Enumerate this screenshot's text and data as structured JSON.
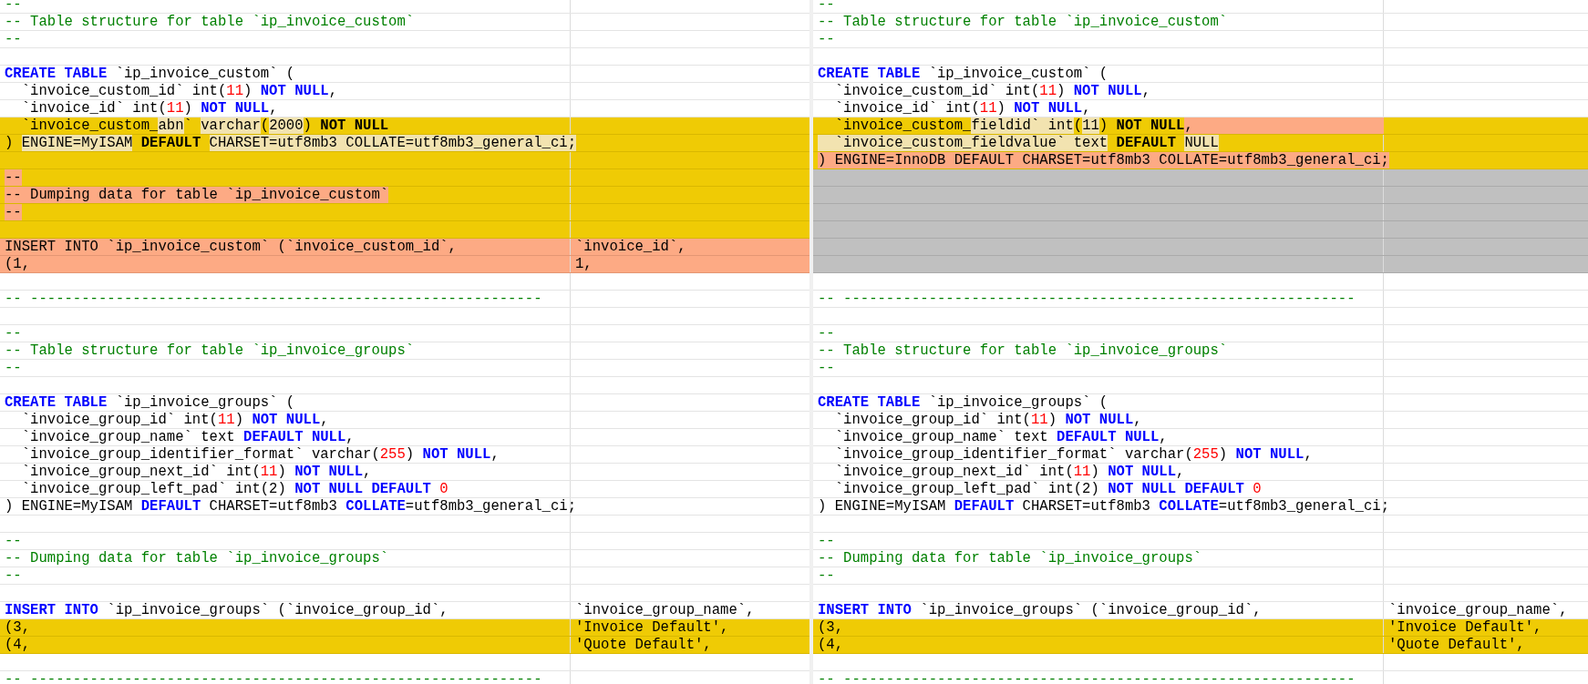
{
  "panes": [
    {
      "rows": [
        {
          "kind": "same",
          "cells": [
            [
              {
                "t": "--",
                "kind": "comment"
              }
            ]
          ]
        },
        {
          "kind": "same",
          "cells": [
            [
              {
                "t": "-- Table structure for table `ip_invoice_custom`",
                "kind": "comment"
              }
            ]
          ]
        },
        {
          "kind": "same",
          "cells": [
            [
              {
                "t": "--",
                "kind": "comment"
              }
            ]
          ]
        },
        {
          "kind": "same"
        },
        {
          "kind": "same",
          "cells": [
            [
              {
                "t": "CREATE TABLE",
                "kind": "keyword"
              },
              {
                "t": " `ip_invoice_custom` ("
              }
            ]
          ]
        },
        {
          "kind": "same",
          "cells": [
            [
              {
                "t": "  `invoice_custom_id` int("
              },
              {
                "t": "11",
                "kind": "number"
              },
              {
                "t": ") "
              },
              {
                "t": "NOT NULL",
                "kind": "keyword"
              },
              {
                "t": ","
              }
            ]
          ]
        },
        {
          "kind": "same",
          "cells": [
            [
              {
                "t": "  `invoice_id` int("
              },
              {
                "t": "11",
                "kind": "number"
              },
              {
                "t": ") "
              },
              {
                "t": "NOT NULL",
                "kind": "keyword"
              },
              {
                "t": ","
              }
            ]
          ]
        },
        {
          "kind": "changed",
          "cells": [
            [
              {
                "t": "  `invoice_custom_"
              },
              {
                "t": "abn",
                "word_changed": true
              },
              {
                "t": "` "
              },
              {
                "t": "varchar",
                "word_changed": true
              },
              {
                "t": "("
              },
              {
                "t": "2000",
                "word_changed": true
              },
              {
                "t": ") "
              },
              {
                "t": "NOT NULL",
                "kind": "keyword"
              }
            ]
          ]
        },
        {
          "kind": "changed",
          "cells": [
            [
              {
                "t": ") "
              },
              {
                "t": "ENGINE=MyISAM",
                "word_changed": true
              },
              {
                "t": " DEFAULT ",
                "kind": "keyword"
              },
              {
                "t": "CHARSET=utf8mb3 COLLATE=utf8mb3_general_ci;",
                "word_changed": true
              }
            ]
          ]
        },
        {
          "kind": "changed"
        },
        {
          "kind": "changed",
          "cells": [
            [
              {
                "t": "--",
                "kind": "comment",
                "deleted": true
              }
            ]
          ]
        },
        {
          "kind": "changed",
          "cells": [
            [
              {
                "t": "-- Dumping data for table `ip_invoice_custom`",
                "kind": "comment",
                "deleted": true
              }
            ]
          ]
        },
        {
          "kind": "changed",
          "cells": [
            [
              {
                "t": "--",
                "kind": "comment",
                "deleted": true
              }
            ]
          ]
        },
        {
          "kind": "changed"
        },
        {
          "kind": "removed",
          "cells": [
            [
              {
                "t": "INSERT INTO `ip_invoice_custom` (`invoice_custom_id`,"
              }
            ],
            [
              {
                "t": "`invoice_id`,"
              }
            ]
          ]
        },
        {
          "kind": "removed",
          "cells": [
            [
              {
                "t": "(1,"
              }
            ],
            [
              {
                "t": "1,"
              }
            ]
          ]
        },
        {
          "kind": "same"
        },
        {
          "kind": "same",
          "cells": [
            [
              {
                "t": "-- ------------------------------------------------------------",
                "kind": "comment"
              }
            ]
          ]
        },
        {
          "kind": "same"
        },
        {
          "kind": "same",
          "cells": [
            [
              {
                "t": "--",
                "kind": "comment"
              }
            ]
          ]
        },
        {
          "kind": "same",
          "cells": [
            [
              {
                "t": "-- Table structure for table `ip_invoice_groups`",
                "kind": "comment"
              }
            ]
          ]
        },
        {
          "kind": "same",
          "cells": [
            [
              {
                "t": "--",
                "kind": "comment"
              }
            ]
          ]
        },
        {
          "kind": "same"
        },
        {
          "kind": "same",
          "cells": [
            [
              {
                "t": "CREATE TABLE",
                "kind": "keyword"
              },
              {
                "t": " `ip_invoice_groups` ("
              }
            ]
          ]
        },
        {
          "kind": "same",
          "cells": [
            [
              {
                "t": "  `invoice_group_id` int("
              },
              {
                "t": "11",
                "kind": "number"
              },
              {
                "t": ") "
              },
              {
                "t": "NOT NULL",
                "kind": "keyword"
              },
              {
                "t": ","
              }
            ]
          ]
        },
        {
          "kind": "same",
          "cells": [
            [
              {
                "t": "  `invoice_group_name` text "
              },
              {
                "t": "DEFAULT NULL",
                "kind": "keyword"
              },
              {
                "t": ","
              }
            ]
          ]
        },
        {
          "kind": "same",
          "cells": [
            [
              {
                "t": "  `invoice_group_identifier_format` varchar("
              },
              {
                "t": "255",
                "kind": "number"
              },
              {
                "t": ") "
              },
              {
                "t": "NOT NULL",
                "kind": "keyword"
              },
              {
                "t": ","
              }
            ]
          ]
        },
        {
          "kind": "same",
          "cells": [
            [
              {
                "t": "  `invoice_group_next_id` int("
              },
              {
                "t": "11",
                "kind": "number"
              },
              {
                "t": ") "
              },
              {
                "t": "NOT NULL",
                "kind": "keyword"
              },
              {
                "t": ","
              }
            ]
          ]
        },
        {
          "kind": "same",
          "cells": [
            [
              {
                "t": "  `invoice_group_left_pad` int(2) "
              },
              {
                "t": "NOT NULL DEFAULT ",
                "kind": "keyword"
              },
              {
                "t": "0",
                "kind": "number"
              }
            ]
          ]
        },
        {
          "kind": "same",
          "cells": [
            [
              {
                "t": ") ENGINE=MyISAM "
              },
              {
                "t": "DEFAULT",
                "kind": "keyword"
              },
              {
                "t": " CHARSET=utf8mb3 "
              },
              {
                "t": "COLLATE",
                "kind": "keyword"
              },
              {
                "t": "=utf8mb3_general_ci;"
              }
            ]
          ]
        },
        {
          "kind": "same"
        },
        {
          "kind": "same",
          "cells": [
            [
              {
                "t": "--",
                "kind": "comment"
              }
            ]
          ]
        },
        {
          "kind": "same",
          "cells": [
            [
              {
                "t": "-- Dumping data for table `ip_invoice_groups`",
                "kind": "comment"
              }
            ]
          ]
        },
        {
          "kind": "same",
          "cells": [
            [
              {
                "t": "--",
                "kind": "comment"
              }
            ]
          ]
        },
        {
          "kind": "same"
        },
        {
          "kind": "same",
          "cells": [
            [
              {
                "t": "INSERT INTO",
                "kind": "keyword"
              },
              {
                "t": " `ip_invoice_groups` (`invoice_group_id`,"
              }
            ],
            [
              {
                "t": "`invoice_group_name`,"
              }
            ]
          ]
        },
        {
          "kind": "changed",
          "cells": [
            [
              {
                "t": "(3,"
              }
            ],
            [
              {
                "t": "'Invoice Default',"
              }
            ]
          ]
        },
        {
          "kind": "changed",
          "cells": [
            [
              {
                "t": "(4,"
              }
            ],
            [
              {
                "t": "'Quote Default',"
              }
            ]
          ]
        },
        {
          "kind": "same"
        },
        {
          "kind": "same",
          "cells": [
            [
              {
                "t": "-- ------------------------------------------------------------",
                "kind": "comment"
              }
            ]
          ]
        }
      ]
    },
    {
      "rows": [
        {
          "kind": "same",
          "cells": [
            [
              {
                "t": "--",
                "kind": "comment"
              }
            ]
          ]
        },
        {
          "kind": "same",
          "cells": [
            [
              {
                "t": "-- Table structure for table `ip_invoice_custom`",
                "kind": "comment"
              }
            ]
          ]
        },
        {
          "kind": "same",
          "cells": [
            [
              {
                "t": "--",
                "kind": "comment"
              }
            ]
          ]
        },
        {
          "kind": "same"
        },
        {
          "kind": "same",
          "cells": [
            [
              {
                "t": "CREATE TABLE",
                "kind": "keyword"
              },
              {
                "t": " `ip_invoice_custom` ("
              }
            ]
          ]
        },
        {
          "kind": "same",
          "cells": [
            [
              {
                "t": "  `invoice_custom_id` int("
              },
              {
                "t": "11",
                "kind": "number"
              },
              {
                "t": ") "
              },
              {
                "t": "NOT NULL",
                "kind": "keyword"
              },
              {
                "t": ","
              }
            ]
          ]
        },
        {
          "kind": "same",
          "cells": [
            [
              {
                "t": "  `invoice_id` int("
              },
              {
                "t": "11",
                "kind": "number"
              },
              {
                "t": ") "
              },
              {
                "t": "NOT NULL",
                "kind": "keyword"
              },
              {
                "t": ","
              }
            ]
          ]
        },
        {
          "kind": "changed",
          "cells": [
            [
              {
                "t": "  `invoice_custom_"
              },
              {
                "t": "fieldid` ",
                "word_changed": true
              },
              {
                "t": "int",
                "word_changed": true
              },
              {
                "t": "("
              },
              {
                "t": "11",
                "word_changed": true
              },
              {
                "t": ") "
              },
              {
                "t": "NOT NULL",
                "kind": "keyword"
              },
              {
                "t": ",",
                "deleted": true,
                "to_end": true
              }
            ]
          ]
        },
        {
          "kind": "changed",
          "cells": [
            [
              {
                "t": "  `invoice_custom_fieldvalue` ",
                "word_changed": true
              },
              {
                "t": "text",
                "word_changed": true
              },
              {
                "t": " DEFAULT ",
                "kind": "keyword"
              },
              {
                "t": "NULL",
                "word_changed": true
              }
            ]
          ]
        },
        {
          "kind": "changed",
          "cells": [
            [
              {
                "t": ") ENGINE=InnoDB DEFAULT CHARSET=utf8mb3 COLLATE=utf8mb3_general_ci;",
                "deleted": true
              }
            ]
          ]
        },
        {
          "kind": "gap"
        },
        {
          "kind": "gap"
        },
        {
          "kind": "gap"
        },
        {
          "kind": "gap"
        },
        {
          "kind": "gap"
        },
        {
          "kind": "gap"
        },
        {
          "kind": "same"
        },
        {
          "kind": "same",
          "cells": [
            [
              {
                "t": "-- ------------------------------------------------------------",
                "kind": "comment"
              }
            ]
          ]
        },
        {
          "kind": "same"
        },
        {
          "kind": "same",
          "cells": [
            [
              {
                "t": "--",
                "kind": "comment"
              }
            ]
          ]
        },
        {
          "kind": "same",
          "cells": [
            [
              {
                "t": "-- Table structure for table `ip_invoice_groups`",
                "kind": "comment"
              }
            ]
          ]
        },
        {
          "kind": "same",
          "cells": [
            [
              {
                "t": "--",
                "kind": "comment"
              }
            ]
          ]
        },
        {
          "kind": "same"
        },
        {
          "kind": "same",
          "cells": [
            [
              {
                "t": "CREATE TABLE",
                "kind": "keyword"
              },
              {
                "t": " `ip_invoice_groups` ("
              }
            ]
          ]
        },
        {
          "kind": "same",
          "cells": [
            [
              {
                "t": "  `invoice_group_id` int("
              },
              {
                "t": "11",
                "kind": "number"
              },
              {
                "t": ") "
              },
              {
                "t": "NOT NULL",
                "kind": "keyword"
              },
              {
                "t": ","
              }
            ]
          ]
        },
        {
          "kind": "same",
          "cells": [
            [
              {
                "t": "  `invoice_group_name` text "
              },
              {
                "t": "DEFAULT NULL",
                "kind": "keyword"
              },
              {
                "t": ","
              }
            ]
          ]
        },
        {
          "kind": "same",
          "cells": [
            [
              {
                "t": "  `invoice_group_identifier_format` varchar("
              },
              {
                "t": "255",
                "kind": "number"
              },
              {
                "t": ") "
              },
              {
                "t": "NOT NULL",
                "kind": "keyword"
              },
              {
                "t": ","
              }
            ]
          ]
        },
        {
          "kind": "same",
          "cells": [
            [
              {
                "t": "  `invoice_group_next_id` int("
              },
              {
                "t": "11",
                "kind": "number"
              },
              {
                "t": ") "
              },
              {
                "t": "NOT NULL",
                "kind": "keyword"
              },
              {
                "t": ","
              }
            ]
          ]
        },
        {
          "kind": "same",
          "cells": [
            [
              {
                "t": "  `invoice_group_left_pad` int(2) "
              },
              {
                "t": "NOT NULL DEFAULT ",
                "kind": "keyword"
              },
              {
                "t": "0",
                "kind": "number"
              }
            ]
          ]
        },
        {
          "kind": "same",
          "cells": [
            [
              {
                "t": ") ENGINE=MyISAM "
              },
              {
                "t": "DEFAULT",
                "kind": "keyword"
              },
              {
                "t": " CHARSET=utf8mb3 "
              },
              {
                "t": "COLLATE",
                "kind": "keyword"
              },
              {
                "t": "=utf8mb3_general_ci;"
              }
            ]
          ]
        },
        {
          "kind": "same"
        },
        {
          "kind": "same",
          "cells": [
            [
              {
                "t": "--",
                "kind": "comment"
              }
            ]
          ]
        },
        {
          "kind": "same",
          "cells": [
            [
              {
                "t": "-- Dumping data for table `ip_invoice_groups`",
                "kind": "comment"
              }
            ]
          ]
        },
        {
          "kind": "same",
          "cells": [
            [
              {
                "t": "--",
                "kind": "comment"
              }
            ]
          ]
        },
        {
          "kind": "same"
        },
        {
          "kind": "same",
          "cells": [
            [
              {
                "t": "INSERT INTO",
                "kind": "keyword"
              },
              {
                "t": " `ip_invoice_groups` (`invoice_group_id`,"
              }
            ],
            [
              {
                "t": "`invoice_group_name`,"
              }
            ]
          ]
        },
        {
          "kind": "changed",
          "cells": [
            [
              {
                "t": "(3,"
              }
            ],
            [
              {
                "t": "'Invoice Default',"
              }
            ]
          ]
        },
        {
          "kind": "changed",
          "cells": [
            [
              {
                "t": "(4,"
              }
            ],
            [
              {
                "t": "'Quote Default',"
              }
            ]
          ]
        },
        {
          "kind": "same"
        },
        {
          "kind": "same",
          "cells": [
            [
              {
                "t": "-- ------------------------------------------------------------",
                "kind": "comment"
              }
            ]
          ]
        }
      ]
    }
  ]
}
